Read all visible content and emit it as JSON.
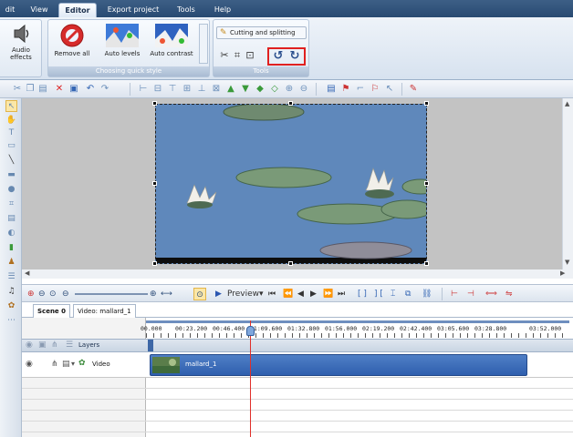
{
  "menu": {
    "tabs": [
      {
        "label": "dit"
      },
      {
        "label": "View"
      },
      {
        "label": "Editor",
        "active": true
      },
      {
        "label": "Export project"
      },
      {
        "label": "Tools"
      },
      {
        "label": "Help"
      }
    ]
  },
  "ribbon": {
    "audio_effects": {
      "line1": "Audio",
      "line2": "effects",
      "icon": "speaker-icon"
    },
    "quick_style": {
      "title": "Choosing quick style",
      "buttons": [
        {
          "label": "Remove all",
          "icon": "remove-all-icon"
        },
        {
          "label": "Auto levels",
          "icon": "auto-levels-icon"
        },
        {
          "label": "Auto contrast",
          "icon": "auto-contrast-icon"
        }
      ]
    },
    "tools": {
      "title": "Tools",
      "cutting_label": "Cutting and splitting",
      "icons": [
        "wand-icon",
        "split-icon",
        "crop-icon",
        "rotate-left-icon",
        "rotate-right-icon"
      ],
      "highlight_color": "#e02020"
    }
  },
  "timeline": {
    "preview_label": "Preview",
    "scene_tab": "Scene 0",
    "video_tab": "Video: mallard_1",
    "ruler_ticks": [
      "00.000",
      "00:23.200",
      "00:46.400",
      "01:09.600",
      "01:32.800",
      "01:56.000",
      "02:19.200",
      "02:42.400",
      "03:05.600",
      "03:28.800",
      "03:52.000"
    ],
    "layers_label": "Layers",
    "video_label": "Video",
    "clip_name": "mallard_1"
  },
  "colors": {
    "accent": "#2b4c74",
    "cursor": "#e0302a",
    "clip": "#3a6bbc"
  }
}
